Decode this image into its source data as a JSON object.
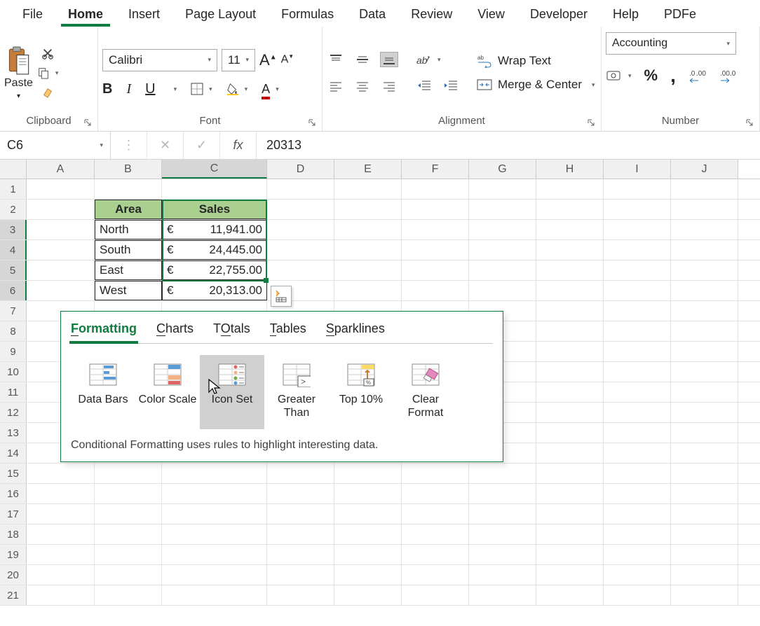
{
  "ribbon": {
    "tabs": [
      "File",
      "Home",
      "Insert",
      "Page Layout",
      "Formulas",
      "Data",
      "Review",
      "View",
      "Developer",
      "Help",
      "PDFe"
    ],
    "active_tab": 1,
    "groups": {
      "clipboard": "Clipboard",
      "font": "Font",
      "alignment": "Alignment",
      "number": "Number"
    },
    "paste_label": "Paste",
    "font_name": "Calibri",
    "font_size": "11",
    "wrap_label": "Wrap Text",
    "merge_label": "Merge & Center",
    "number_format": "Accounting"
  },
  "formula_bar": {
    "name_box": "C6",
    "value": "20313"
  },
  "grid": {
    "columns": [
      "A",
      "B",
      "C",
      "D",
      "E",
      "F",
      "G",
      "H",
      "I",
      "J"
    ],
    "rows": 21,
    "table": {
      "headers": [
        "Area",
        "Sales"
      ],
      "data": [
        {
          "area": "North",
          "currency": "€",
          "sales": "11,941.00"
        },
        {
          "area": "South",
          "currency": "€",
          "sales": "24,445.00"
        },
        {
          "area": "East",
          "currency": "€",
          "sales": "22,755.00"
        },
        {
          "area": "West",
          "currency": "€",
          "sales": "20,313.00"
        }
      ]
    },
    "selected_cell": "C6",
    "selected_rows": [
      3,
      4,
      5,
      6
    ],
    "selected_col": "C"
  },
  "quick_analysis": {
    "tabs": [
      {
        "letter": "F",
        "rest": "ormatting"
      },
      {
        "letter": "C",
        "rest": "harts"
      },
      {
        "letter": "O",
        "pre": "T",
        "rest": "tals"
      },
      {
        "letter": "T",
        "rest": "ables"
      },
      {
        "letter": "S",
        "rest": "parklines"
      }
    ],
    "active_tab": 0,
    "items": [
      "Data Bars",
      "Color Scale",
      "Icon Set",
      "Greater Than",
      "Top 10%",
      "Clear Format"
    ],
    "hover_item": 2,
    "description": "Conditional Formatting uses rules to highlight interesting data."
  }
}
